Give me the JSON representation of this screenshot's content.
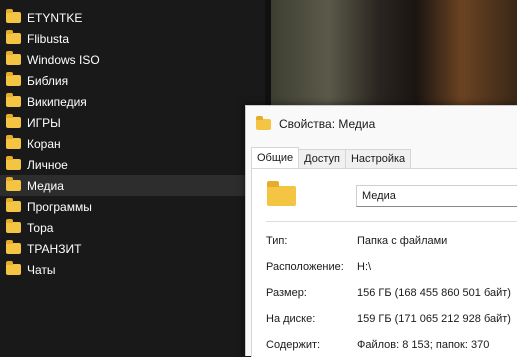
{
  "sidebar": {
    "items": [
      {
        "label": "ETYNTKE"
      },
      {
        "label": "Flibusta"
      },
      {
        "label": "Windows ISO"
      },
      {
        "label": "Библия"
      },
      {
        "label": "Википедия"
      },
      {
        "label": "ИГРЫ"
      },
      {
        "label": "Коран"
      },
      {
        "label": "Личное"
      },
      {
        "label": "Медиа",
        "selected": true
      },
      {
        "label": "Программы"
      },
      {
        "label": "Тора"
      },
      {
        "label": "ТРАНЗИТ"
      },
      {
        "label": "Чаты"
      }
    ]
  },
  "dialog": {
    "title": "Свойства: Медиа",
    "tabs": [
      {
        "label": "Общие",
        "active": true
      },
      {
        "label": "Доступ"
      },
      {
        "label": "Настройка"
      }
    ],
    "name_value": "Медиа",
    "properties": [
      {
        "label": "Тип:",
        "value": "Папка с файлами"
      },
      {
        "label": "Расположение:",
        "value": "H:\\"
      },
      {
        "label": "Размер:",
        "value": "156 ГБ (168 455 860 501 байт)"
      },
      {
        "label": "На диске:",
        "value": "159 ГБ (171 065 212 928 байт)"
      },
      {
        "label": "Содержит:",
        "value": "Файлов: 8 153; папок: 370"
      }
    ]
  },
  "colors": {
    "folder": "#f4c443",
    "sidebar_bg": "#191919",
    "selected_bg": "#2d2d2d",
    "dialog_bg": "#f9f9f9"
  },
  "icons": {
    "nav": "folder-icon",
    "title": "folder-icon",
    "large": "folder-large-icon"
  }
}
